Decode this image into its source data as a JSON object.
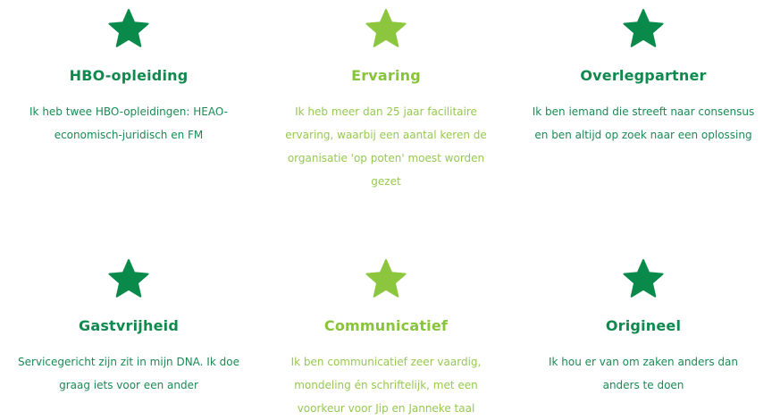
{
  "colors": {
    "dark_green": "#0f8a4f",
    "light_green": "#88c43a",
    "star_dark": "#0a8a4a",
    "star_light": "#8cc63f"
  },
  "features": [
    {
      "icon": "star-icon",
      "title": "HBO-opleiding",
      "text": "Ik heb twee HBO-opleidingen: HEAO-economisch-juridisch en FM"
    },
    {
      "icon": "star-icon",
      "title": "Ervaring",
      "text": "Ik heb meer dan 25 jaar facilitaire ervaring, waarbij een aantal keren de organisatie 'op poten' moest worden gezet"
    },
    {
      "icon": "star-icon",
      "title": "Overlegpartner",
      "text": "Ik ben iemand die streeft naar consensus en ben altijd op zoek naar een oplossing"
    },
    {
      "icon": "star-icon",
      "title": "Gastvrijheid",
      "text": "Servicegericht zijn zit in mijn DNA. Ik doe graag iets voor een ander"
    },
    {
      "icon": "star-icon",
      "title": "Communicatief",
      "text": "Ik ben communicatief zeer vaardig, mondeling én schriftelijk, met een voorkeur voor Jip en Janneke taal"
    },
    {
      "icon": "star-icon",
      "title": "Origineel",
      "text": "Ik hou er van om zaken anders dan anders te doen"
    }
  ]
}
